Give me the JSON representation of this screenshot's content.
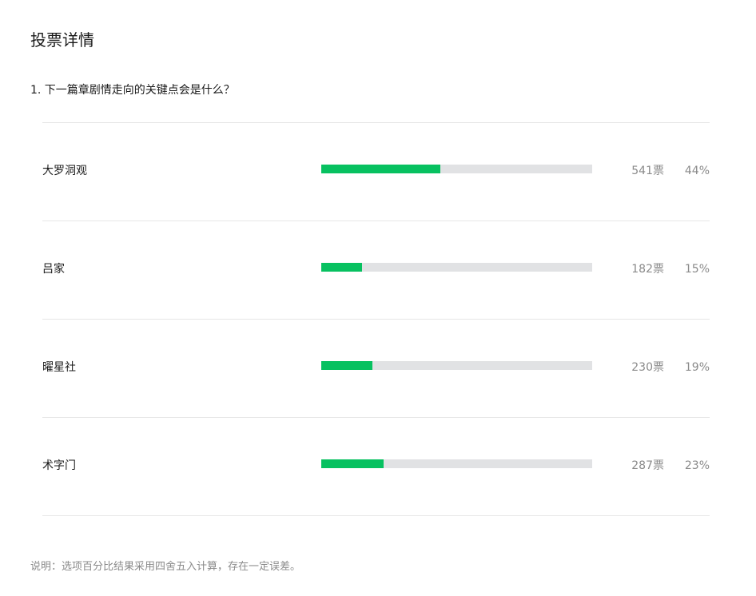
{
  "page": {
    "title": "投票详情"
  },
  "question": {
    "text": "1. 下一篇章剧情走向的关键点会是什么？"
  },
  "options": [
    {
      "label": "大罗洞观",
      "votes": "541票",
      "percent": "44%",
      "ratio": 0.44
    },
    {
      "label": "吕家",
      "votes": "182票",
      "percent": "15%",
      "ratio": 0.15
    },
    {
      "label": "曜星社",
      "votes": "230票",
      "percent": "19%",
      "ratio": 0.19
    },
    {
      "label": "术字门",
      "votes": "287票",
      "percent": "23%",
      "ratio": 0.23
    }
  ],
  "footnote": {
    "text": "说明：选项百分比结果采用四舍五入计算，存在一定误差。"
  },
  "colors": {
    "bar_fill": "#07c160",
    "bar_track": "#e1e2e4",
    "muted_text": "#8a8a8a"
  }
}
